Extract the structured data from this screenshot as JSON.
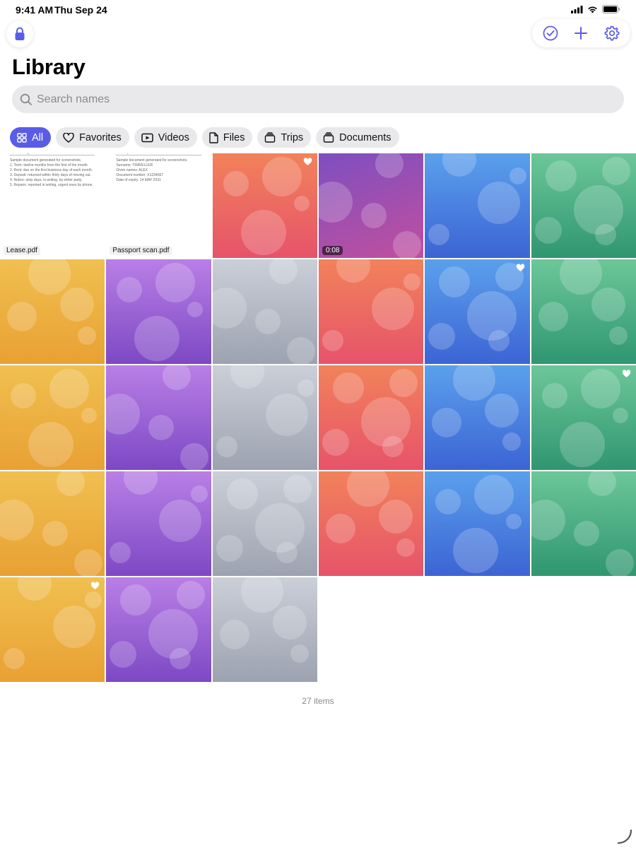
{
  "status": {
    "time": "9:41 AM",
    "date": "Thu Sep 24"
  },
  "header": {
    "title": "Library"
  },
  "search": {
    "placeholder": "Search names",
    "value": ""
  },
  "filters": [
    {
      "label": "All",
      "icon": "grid-icon",
      "active": true
    },
    {
      "label": "Favorites",
      "icon": "heart-icon",
      "active": false
    },
    {
      "label": "Videos",
      "icon": "video-icon",
      "active": false
    },
    {
      "label": "Files",
      "icon": "document-icon",
      "active": false
    },
    {
      "label": "Trips",
      "icon": "folder-icon",
      "active": false
    },
    {
      "label": "Documents",
      "icon": "folder-icon",
      "active": false
    }
  ],
  "colors": {
    "accent": "#5b5ce6",
    "orange": "#e9a033",
    "purple": "#9b63d6",
    "gray": "#b4b9c4",
    "red": "#ec6a60",
    "blue": "#4a80e0",
    "green": "#4db084"
  },
  "items": [
    {
      "kind": "document",
      "name": "Lease.pdf",
      "doc_title": "Lease agreement",
      "doc_lines": [
        "Sample document generated for screenshots.",
        "1. Term: twelve months from the first of the month.",
        "2. Rent: due on the first business day of each month.",
        "3. Deposit: returned within thirty days of moving out.",
        "4. Notice: sixty days, in writing, by either party.",
        "5. Repairs: reported in writing, urgent ones by phone."
      ]
    },
    {
      "kind": "document",
      "name": "Passport scan.pdf",
      "doc_title": "Passport scan",
      "doc_lines": [
        "Sample document generated for screenshots.",
        "Surname: TRAVELLER",
        "Given names: ALEX",
        "Document number: X1234567",
        "Date of expiry: 14 MAY 2031"
      ]
    },
    {
      "kind": "photo",
      "color": "red",
      "favorite": true
    },
    {
      "kind": "video",
      "color": "violet",
      "duration": "0:08"
    },
    {
      "kind": "photo",
      "color": "blue"
    },
    {
      "kind": "photo",
      "color": "green"
    },
    {
      "kind": "photo",
      "color": "orange"
    },
    {
      "kind": "photo",
      "color": "purple"
    },
    {
      "kind": "photo",
      "color": "gray"
    },
    {
      "kind": "photo",
      "color": "red"
    },
    {
      "kind": "photo",
      "color": "blue",
      "favorite": true
    },
    {
      "kind": "photo",
      "color": "green"
    },
    {
      "kind": "photo",
      "color": "orange"
    },
    {
      "kind": "photo",
      "color": "purple"
    },
    {
      "kind": "photo",
      "color": "gray"
    },
    {
      "kind": "photo",
      "color": "red"
    },
    {
      "kind": "photo",
      "color": "blue"
    },
    {
      "kind": "photo",
      "color": "green",
      "favorite": true
    },
    {
      "kind": "photo",
      "color": "orange"
    },
    {
      "kind": "photo",
      "color": "purple"
    },
    {
      "kind": "photo",
      "color": "gray"
    },
    {
      "kind": "photo",
      "color": "red"
    },
    {
      "kind": "photo",
      "color": "blue"
    },
    {
      "kind": "photo",
      "color": "green"
    },
    {
      "kind": "photo",
      "color": "orange",
      "favorite": true
    },
    {
      "kind": "photo",
      "color": "purple"
    },
    {
      "kind": "photo",
      "color": "gray"
    }
  ],
  "footer": {
    "count_label": "27 items"
  }
}
